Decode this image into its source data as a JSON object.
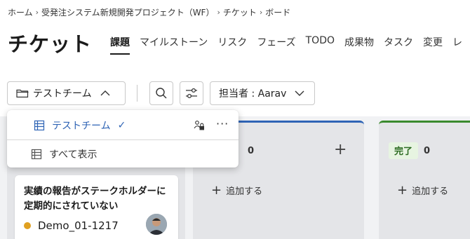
{
  "breadcrumb": {
    "home": "ホーム",
    "project": "受発注システム新規開発プロジェクト（WF）",
    "tickets": "チケット",
    "board": "ボード"
  },
  "page_title": "チケット",
  "tabs": [
    "課題",
    "マイルストーン",
    "リスク",
    "フェーズ",
    "TODO",
    "成果物",
    "タスク",
    "変更",
    "レ"
  ],
  "toolbar": {
    "team_label": "テストチーム",
    "assignee_label": "担当者 : Aarav"
  },
  "dropdown": {
    "items": [
      {
        "label": "テストチーム",
        "selected": true
      },
      {
        "label": "すべて表示",
        "selected": false
      }
    ]
  },
  "columns": [
    {
      "count": "0",
      "add_label": "追加する"
    },
    {
      "status": "完了",
      "count": "0",
      "add_label": "追加する"
    }
  ],
  "card": {
    "title": "実績の報告がステークホルダーに定期的にされていない",
    "id": "Demo_01-1217",
    "status_color": "#e0a020"
  },
  "colors": {
    "accent": "#2f64b5",
    "done": "#3a8a2e"
  }
}
